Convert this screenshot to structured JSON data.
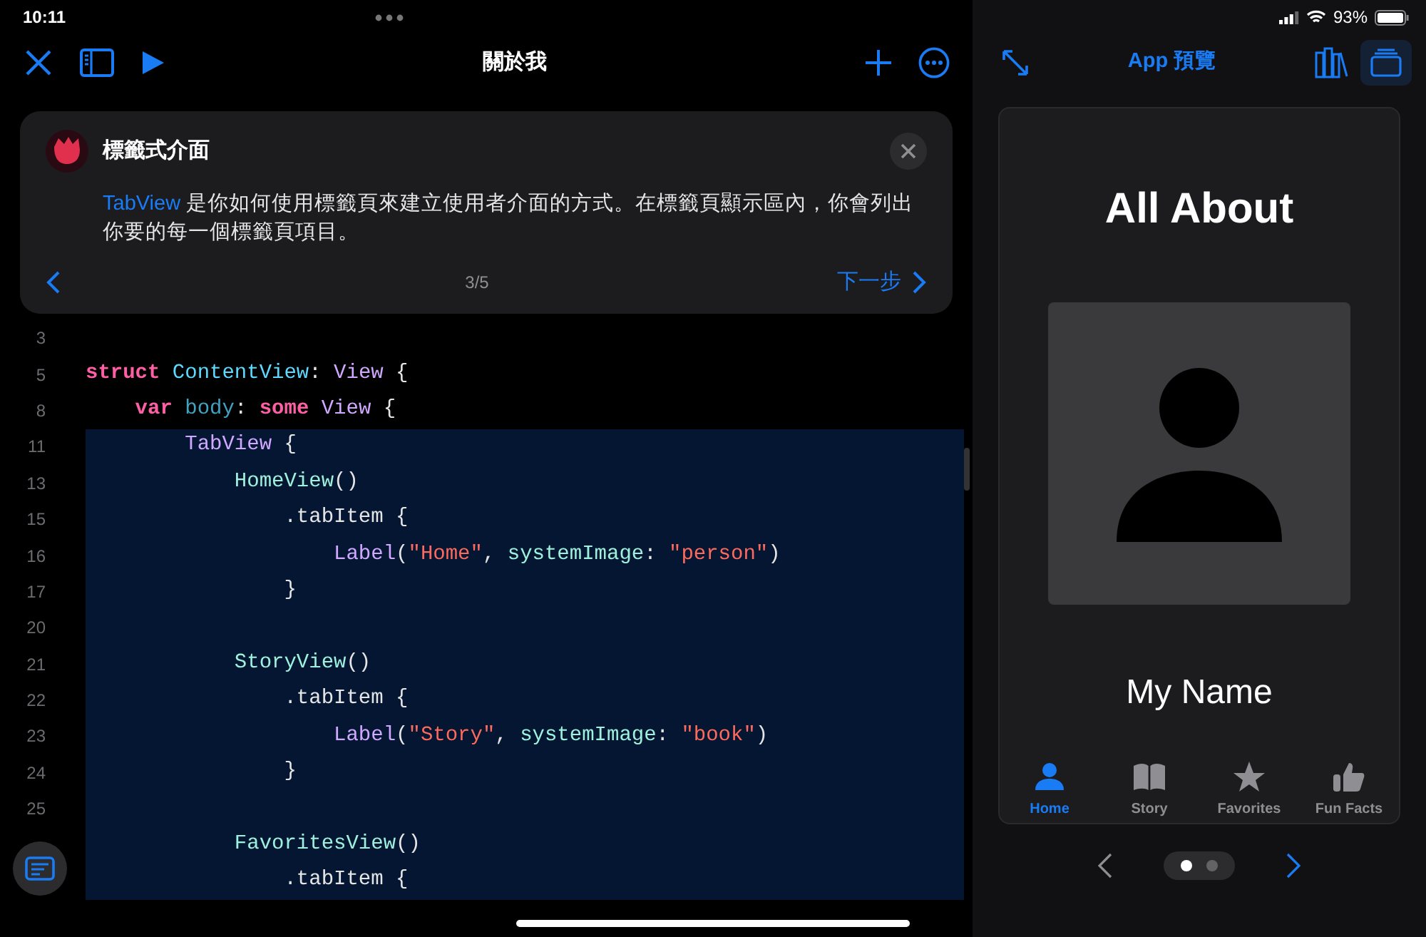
{
  "status_bar": {
    "time": "10:11",
    "battery": "93%"
  },
  "editor_toolbar": {
    "title": "關於我"
  },
  "guide_card": {
    "title": "標籤式介面",
    "parts": [
      {
        "kind": "code",
        "text": "TabView"
      },
      {
        "kind": "plain",
        "text": " 是你如何使用標籤頁來建立使用者介面的方式。在標籤頁顯示區內，你會列出你要的每一個標籤頁項目。"
      }
    ],
    "page": "3/5",
    "next": "下一步"
  },
  "code_lines": [
    {
      "num": "3",
      "highlighted": false
    },
    {
      "num": "5",
      "highlighted": false,
      "tokens": [
        {
          "kind": "kw",
          "text": "struct "
        },
        {
          "kind": "decl",
          "text": "ContentView"
        },
        {
          "kind": "plain",
          "text": ": "
        },
        {
          "kind": "type",
          "text": "View"
        },
        {
          "kind": "plain",
          "text": " {"
        }
      ]
    },
    {
      "num": "8",
      "highlighted": false,
      "tokens": [
        {
          "kind": "kw",
          "text": "    var "
        },
        {
          "kind": "prop",
          "text": "body"
        },
        {
          "kind": "plain",
          "text": ": "
        },
        {
          "kind": "kw",
          "text": "some "
        },
        {
          "kind": "type",
          "text": "View"
        },
        {
          "kind": "plain",
          "text": " {"
        }
      ]
    },
    {
      "num": "11",
      "highlighted": true,
      "tokens": [
        {
          "kind": "type",
          "text": "        TabView"
        },
        {
          "kind": "plain",
          "text": " {"
        }
      ]
    },
    {
      "num": "13",
      "highlighted": true,
      "tokens": [
        {
          "kind": "call",
          "text": "            HomeView"
        },
        {
          "kind": "plain",
          "text": "()"
        }
      ]
    },
    {
      "num": "15",
      "highlighted": true,
      "tokens": [
        {
          "kind": "plain",
          "text": "                .tabItem {"
        }
      ]
    },
    {
      "num": "16",
      "highlighted": true,
      "tokens": [
        {
          "kind": "type",
          "text": "                    Label"
        },
        {
          "kind": "plain",
          "text": "("
        },
        {
          "kind": "str",
          "text": "\"Home\""
        },
        {
          "kind": "plain",
          "text": ", "
        },
        {
          "kind": "call",
          "text": "systemImage"
        },
        {
          "kind": "plain",
          "text": ": "
        },
        {
          "kind": "str",
          "text": "\"person\""
        },
        {
          "kind": "plain",
          "text": ")"
        }
      ]
    },
    {
      "num": "17",
      "highlighted": true,
      "tokens": [
        {
          "kind": "plain",
          "text": "                }"
        }
      ]
    },
    {
      "num": "20",
      "highlighted": true
    },
    {
      "num": "21",
      "highlighted": true,
      "tokens": [
        {
          "kind": "call",
          "text": "            StoryView"
        },
        {
          "kind": "plain",
          "text": "()"
        }
      ]
    },
    {
      "num": "22",
      "highlighted": true,
      "tokens": [
        {
          "kind": "plain",
          "text": "                .tabItem {"
        }
      ]
    },
    {
      "num": "23",
      "highlighted": true,
      "tokens": [
        {
          "kind": "type",
          "text": "                    Label"
        },
        {
          "kind": "plain",
          "text": "("
        },
        {
          "kind": "str",
          "text": "\"Story\""
        },
        {
          "kind": "plain",
          "text": ", "
        },
        {
          "kind": "call",
          "text": "systemImage"
        },
        {
          "kind": "plain",
          "text": ": "
        },
        {
          "kind": "str",
          "text": "\"book\""
        },
        {
          "kind": "plain",
          "text": ")"
        }
      ]
    },
    {
      "num": "24",
      "highlighted": true,
      "tokens": [
        {
          "kind": "plain",
          "text": "                }"
        }
      ]
    },
    {
      "num": "25",
      "highlighted": true
    },
    {
      "highlighted": true,
      "tokens": [
        {
          "kind": "call",
          "text": "            FavoritesView"
        },
        {
          "kind": "plain",
          "text": "()"
        }
      ]
    },
    {
      "highlighted": true,
      "tokens": [
        {
          "kind": "plain",
          "text": "                .tabItem {"
        }
      ]
    }
  ],
  "preview": {
    "title": "App 預覽",
    "heading": "All About",
    "name": "My Name",
    "tabs": [
      {
        "kind": "person",
        "label": "Home",
        "selected": true
      },
      {
        "kind": "book",
        "label": "Story",
        "selected": false
      },
      {
        "kind": "star",
        "label": "Favorites",
        "selected": false
      },
      {
        "kind": "thumb",
        "label": "Fun Facts",
        "selected": false
      }
    ],
    "pages": [
      {
        "selected": true
      },
      {
        "selected": false
      }
    ]
  }
}
